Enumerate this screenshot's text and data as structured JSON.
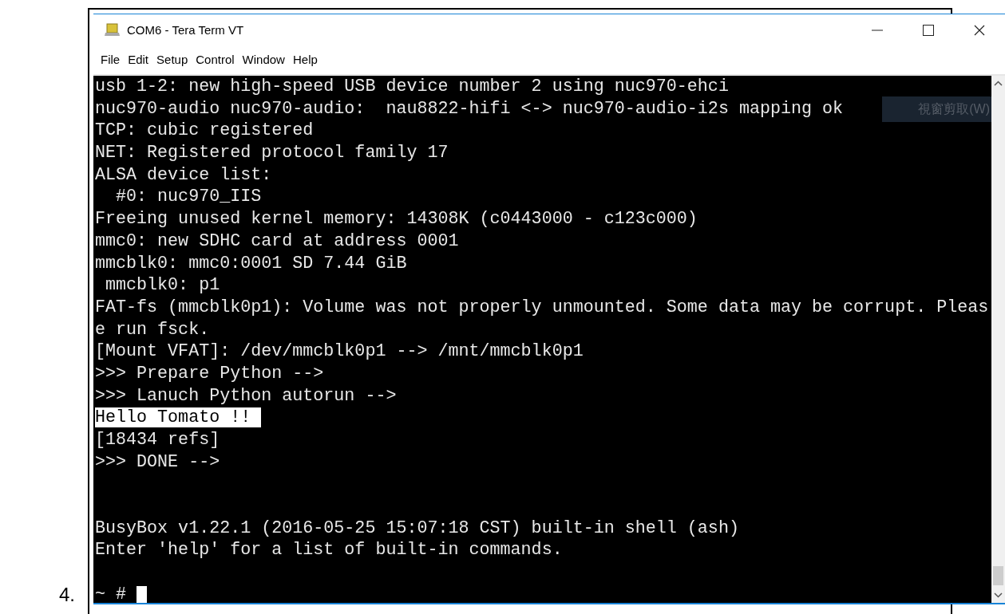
{
  "list_marker": "4.",
  "window": {
    "title": "COM6 - Tera Term VT"
  },
  "menu": [
    "File",
    "Edit",
    "Setup",
    "Control",
    "Window",
    "Help"
  ],
  "overlay_label": "視窗剪取(W)",
  "terminal": {
    "lines": [
      {
        "kind": "text",
        "text": "usb 1-2: new high-speed USB device number 2 using nuc970-ehci"
      },
      {
        "kind": "text",
        "text": "nuc970-audio nuc970-audio:  nau8822-hifi <-> nuc970-audio-i2s mapping ok"
      },
      {
        "kind": "text",
        "text": "TCP: cubic registered"
      },
      {
        "kind": "text",
        "text": "NET: Registered protocol family 17"
      },
      {
        "kind": "text",
        "text": "ALSA device list:"
      },
      {
        "kind": "text",
        "text": "  #0: nuc970_IIS"
      },
      {
        "kind": "text",
        "text": "Freeing unused kernel memory: 14308K (c0443000 - c123c000)"
      },
      {
        "kind": "text",
        "text": "mmc0: new SDHC card at address 0001"
      },
      {
        "kind": "text",
        "text": "mmcblk0: mmc0:0001 SD 7.44 GiB"
      },
      {
        "kind": "text",
        "text": " mmcblk0: p1"
      },
      {
        "kind": "text",
        "text": "FAT-fs (mmcblk0p1): Volume was not properly unmounted. Some data may be corrupt. Pleas"
      },
      {
        "kind": "text",
        "text": "e run fsck."
      },
      {
        "kind": "text",
        "text": "[Mount VFAT]: /dev/mmcblk0p1 --> /mnt/mmcblk0p1"
      },
      {
        "kind": "text",
        "text": ">>> Prepare Python -->"
      },
      {
        "kind": "text",
        "text": ">>> Lanuch Python autorun -->"
      },
      {
        "kind": "highlighted",
        "text": "Hello Tomato !!"
      },
      {
        "kind": "text",
        "text": "[18434 refs]"
      },
      {
        "kind": "text",
        "text": ">>> DONE -->"
      },
      {
        "kind": "blank"
      },
      {
        "kind": "blank"
      },
      {
        "kind": "text",
        "text": "BusyBox v1.22.1 (2016-05-25 15:07:18 CST) built-in shell (ash)"
      },
      {
        "kind": "text",
        "text": "Enter 'help' for a list of built-in commands."
      },
      {
        "kind": "blank"
      },
      {
        "kind": "prompt",
        "text": "~ #"
      }
    ]
  }
}
